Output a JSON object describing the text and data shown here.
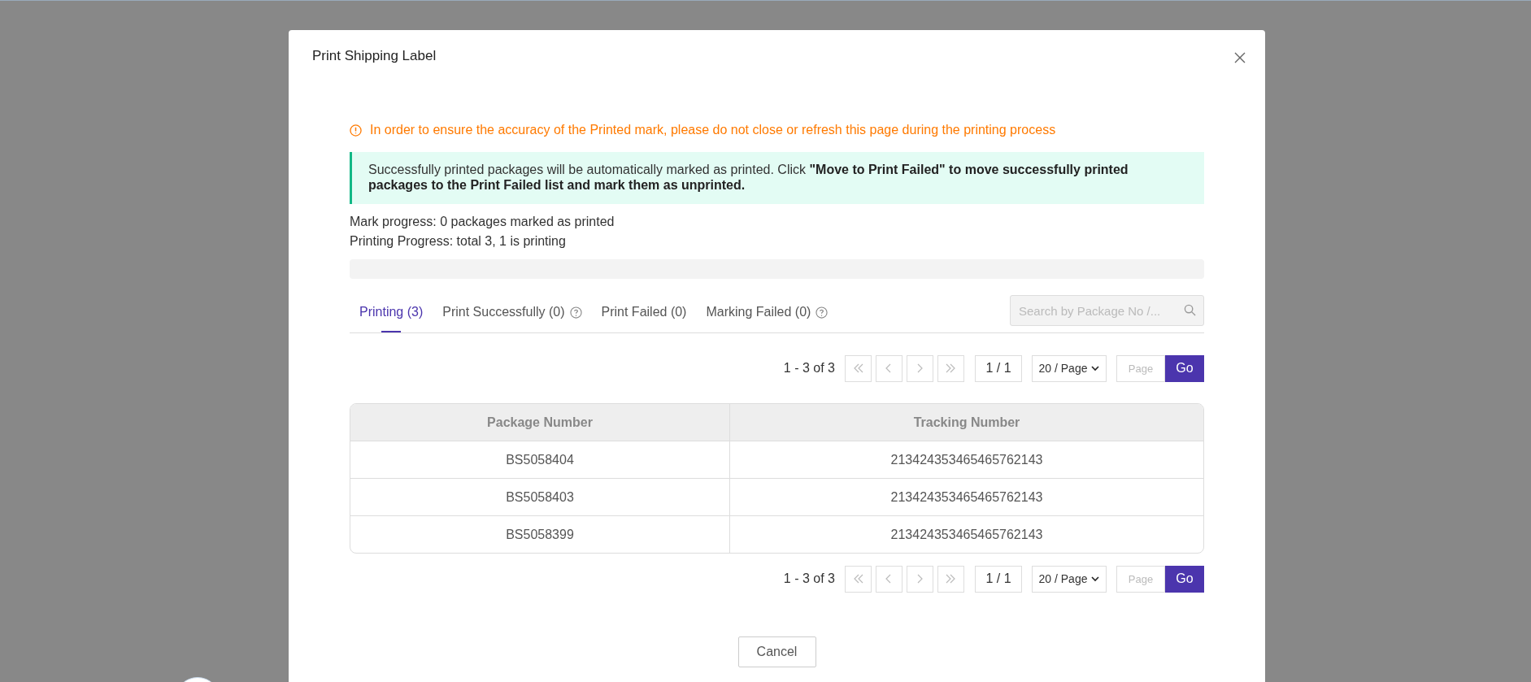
{
  "dialog": {
    "title": "Print Shipping Label",
    "warning": "In order to ensure the accuracy of the Printed mark, please do not close or refresh this page during the printing process",
    "notice": "Successfully printed packages will be automatically marked as printed. Click **\"Move to Print Failed\" to move successfully printed packages to the Print Failed list and mark them as unprinted.**",
    "mark_progress": "Mark progress: 0 packages marked as printed",
    "printing_progress": "Printing Progress: total 3, 1 is printing",
    "progress_bar": {
      "level": 0
    },
    "tabs": [
      {
        "label": "Printing (3)",
        "selected": true,
        "help": false
      },
      {
        "label": "Print Successfully (0)",
        "selected": false,
        "help": true
      },
      {
        "label": "Print Failed (0)",
        "selected": false,
        "help": false
      },
      {
        "label": "Marking Failed (0)",
        "selected": false,
        "help": true
      }
    ],
    "search": {
      "placeholder": "Search by Package No /..."
    },
    "pagination_top": {
      "range": "1 - 3 of 3",
      "buttons": [
        {
          "kind": "first",
          "disabled": true
        },
        {
          "kind": "prev",
          "disabled": true
        },
        {
          "kind": "next",
          "disabled": true
        },
        {
          "kind": "last",
          "disabled": true
        }
      ],
      "page": "1 / 1",
      "page_size": "20 / Page",
      "jump_placeholder": "Page",
      "go": "Go"
    },
    "table": {
      "columns": [
        "Package Number",
        "Tracking Number"
      ],
      "rows": [
        [
          "BS5058404",
          "213424353465465762143"
        ],
        [
          "BS5058403",
          "213424353465465762143"
        ],
        [
          "BS5058399",
          "213424353465465762143"
        ]
      ]
    },
    "pagination_bottom": {
      "range": "1 - 3 of 3",
      "buttons": [
        {
          "kind": "first",
          "disabled": true
        },
        {
          "kind": "prev",
          "disabled": true
        },
        {
          "kind": "next",
          "disabled": true
        },
        {
          "kind": "last",
          "disabled": true
        }
      ],
      "page": "1 / 1",
      "page_size": "20 / Page",
      "jump_placeholder": "Page",
      "go": "Go"
    },
    "cancel": "Cancel"
  }
}
